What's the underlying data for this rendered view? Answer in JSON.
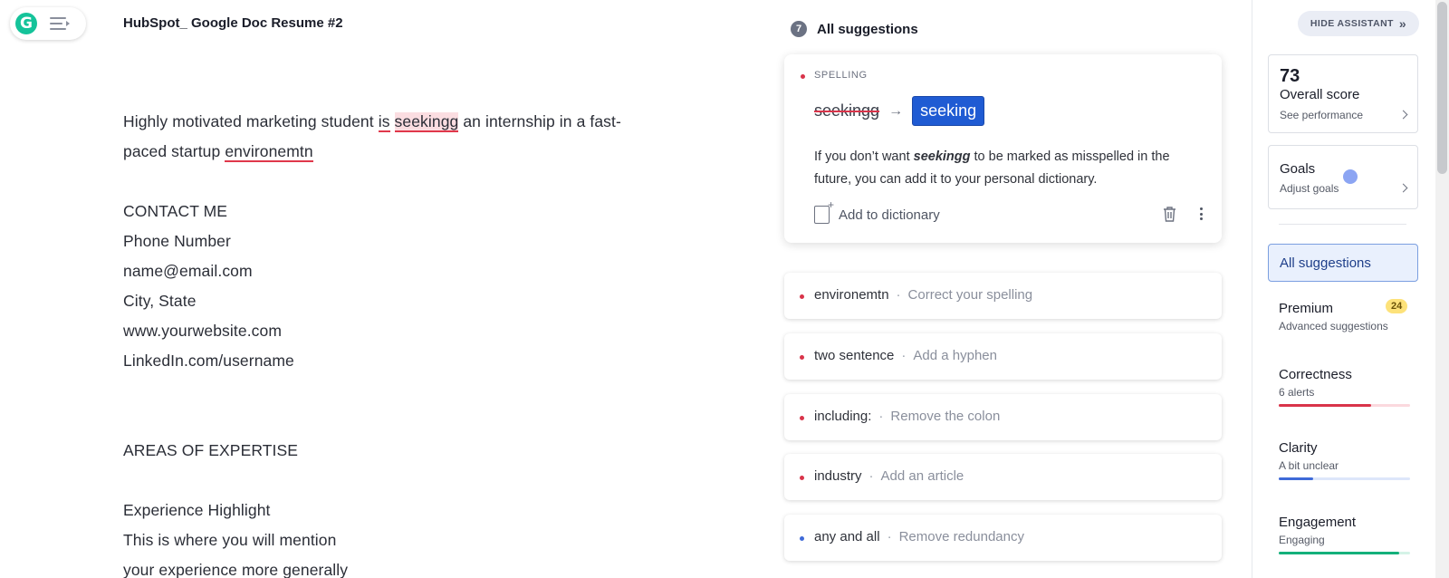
{
  "app": {
    "logo": "G",
    "logo_icon": "grammarly-logo-icon",
    "menu_icon": "menu-icon"
  },
  "document": {
    "title": "HubSpot_ Google Doc Resume #2",
    "lines": {
      "l1_a": "Highly motivated marketing student ",
      "l1_is": "is",
      "l1_space": " ",
      "l1_seekingg": "seekingg",
      "l1_b": " an internship in a fast-",
      "l2_a": "paced startup ",
      "l2_env": "environemtn",
      "contact": "CONTACT ME",
      "phone": "Phone Number",
      "email": "name@email.com",
      "city": "City, State",
      "website": "www.yourwebsite.com",
      "linkedin": "LinkedIn.com/username",
      "areas": "AREAS OF EXPERTISE",
      "exp": "Experience Highlight",
      "exp1": "This is where you will mention",
      "exp2": "your experience more generally"
    }
  },
  "suggestions": {
    "count": "7",
    "header": "All suggestions",
    "main": {
      "category": "SPELLING",
      "original": "seekingg",
      "arrow": "→",
      "replacement": "seeking",
      "explain_a": "If you don’t want ",
      "explain_word": "seekingg",
      "explain_b": " to be marked as misspelled in the future, you can add it to your personal dictionary.",
      "add_label": "Add to dictionary"
    },
    "items": [
      {
        "word": "environemtn",
        "hint": "Correct your spelling",
        "dot_color": "#d9344a"
      },
      {
        "word": "two sentence",
        "hint": "Add a hyphen",
        "dot_color": "#d9344a"
      },
      {
        "word": "including:",
        "hint": "Remove the colon",
        "dot_color": "#d9344a"
      },
      {
        "word": "industry",
        "hint": "Add an article",
        "dot_color": "#d9344a"
      },
      {
        "word": "any and all",
        "hint": "Remove redundancy",
        "dot_color": "#3f6ad8"
      }
    ],
    "separator": "·"
  },
  "sidebar": {
    "hide_label": "HIDE ASSISTANT",
    "hide_icon": "»",
    "score": {
      "value": "73",
      "label": "Overall score",
      "link": "See performance"
    },
    "goals": {
      "label": "Goals",
      "link": "Adjust goals"
    },
    "all_suggestions": "All suggestions",
    "premium": {
      "name": "Premium",
      "sub": "Advanced suggestions",
      "badge": "24"
    },
    "correctness": {
      "name": "Correctness",
      "sub": "6 alerts",
      "color": "#d9344a",
      "track": "#fbd9de",
      "level": 0.7
    },
    "clarity": {
      "name": "Clarity",
      "sub": "A bit unclear",
      "color": "#3f6ad8",
      "track": "#dde6fa",
      "level": 0.26
    },
    "engagement": {
      "name": "Engagement",
      "sub": "Engaging",
      "color": "#14b07b",
      "track": "#d5f3e7",
      "level": 0.92
    }
  }
}
